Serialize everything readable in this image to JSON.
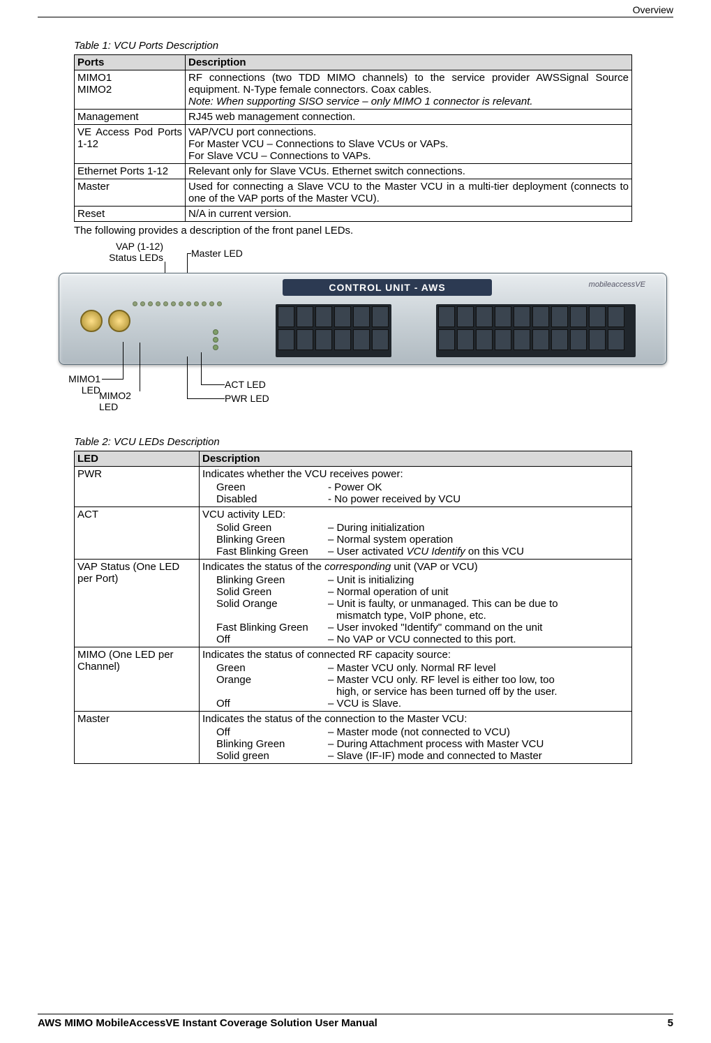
{
  "header": {
    "section": "Overview"
  },
  "table1": {
    "caption": "Table 1: VCU Ports Description",
    "headers": {
      "ports": "Ports",
      "description": "Description"
    },
    "rows": [
      {
        "port": "MIMO1\nMIMO2",
        "desc": "RF connections (two TDD MIMO channels) to the service provider AWSSignal Source equipment. N-Type female connectors. Coax cables.",
        "note": "Note: When supporting SISO service – only MIMO 1 connector is relevant."
      },
      {
        "port": "Management",
        "desc": "RJ45 web management connection."
      },
      {
        "port": "VE Access Pod Ports 1-12",
        "desc": "VAP/VCU port connections.\nFor Master VCU – Connections to Slave VCUs or VAPs.\nFor Slave VCU – Connections to VAPs."
      },
      {
        "port": "Ethernet Ports 1-12",
        "desc": "Relevant only for Slave VCUs. Ethernet switch connections."
      },
      {
        "port": "Master",
        "desc": "Used for connecting a Slave VCU to the Master VCU in a multi-tier deployment (connects to one of the VAP ports of the Master VCU)."
      },
      {
        "port": "Reset",
        "desc": "N/A in current version."
      }
    ]
  },
  "lead_text": "The following provides a description of the front panel LEDs.",
  "figure": {
    "labels": {
      "vap": "VAP (1-12)\nStatus LEDs",
      "master_led": "Master LED",
      "mimo1": "MIMO1\nLED",
      "mimo2": "MIMO2\nLED",
      "act": "ACT LED",
      "pwr": "PWR LED",
      "banner": "CONTROL UNIT - AWS",
      "logo": "mobileaccessVE"
    }
  },
  "table2": {
    "caption": "Table 2: VCU LEDs Description",
    "headers": {
      "led": "LED",
      "description": "Description"
    },
    "rows": [
      {
        "led": "PWR",
        "intro": "Indicates whether the VCU receives power:",
        "items": [
          {
            "k": "Green",
            "v": "- Power OK"
          },
          {
            "k": "Disabled",
            "v": "- No power received by VCU"
          }
        ]
      },
      {
        "led": "ACT",
        "intro": "VCU activity LED:",
        "items": [
          {
            "k": "Solid Green",
            "v": "– During initialization"
          },
          {
            "k": "Blinking Green",
            "v": "– Normal system operation"
          },
          {
            "k": "Fast Blinking Green",
            "v_pre": "– User activated ",
            "v_ital": "VCU Identify",
            "v_post": " on this VCU"
          }
        ]
      },
      {
        "led": "VAP Status (One LED per Port)",
        "intro_pre": "Indicates the status of the ",
        "intro_ital": "corresponding",
        "intro_post": " unit (VAP or VCU)",
        "items": [
          {
            "k": "Blinking Green",
            "v": "– Unit is initializing"
          },
          {
            "k": "Solid Green",
            "v": "– Normal operation of unit"
          },
          {
            "k": "Solid Orange",
            "v": "– Unit is faulty, or unmanaged. This can be due to mismatch type, VoIP phone, etc."
          },
          {
            "k": "Fast Blinking Green",
            "v": "– User invoked \"Identify\" command on the unit"
          },
          {
            "k": "Off",
            "v": "– No VAP or VCU connected to this port."
          }
        ]
      },
      {
        "led": "MIMO (One LED per Channel)",
        "intro": "Indicates the status of connected RF capacity source:",
        "items": [
          {
            "k": "Green",
            "v": "– Master VCU only. Normal RF level"
          },
          {
            "k": "Orange",
            "v": "– Master VCU only. RF level is either too low, too high, or service has been turned off by the user."
          },
          {
            "k": "Off",
            "v": "– VCU is Slave."
          }
        ]
      },
      {
        "led": "Master",
        "intro": "Indicates the status of the connection to the Master VCU:",
        "items": [
          {
            "k": "Off",
            "v": "– Master mode (not connected to VCU)"
          },
          {
            "k": "Blinking Green",
            "v": "– During Attachment process with Master VCU"
          },
          {
            "k": "Solid green",
            "v": "– Slave (IF-IF) mode and connected to Master"
          }
        ]
      }
    ]
  },
  "footer": {
    "title": "AWS MIMO MobileAccessVE Instant Coverage Solution User Manual",
    "page": "5"
  }
}
